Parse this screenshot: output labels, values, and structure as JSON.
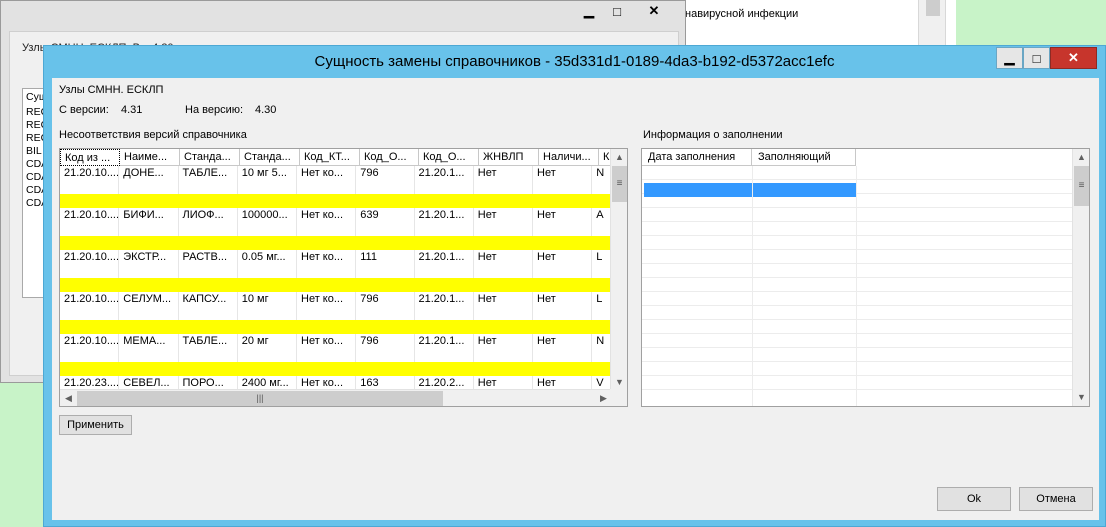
{
  "background_doc": {
    "text": "навирусной инфекции"
  },
  "background_window": {
    "label": "Узлы СМНН. ЕСКЛП. В...     4.30",
    "list_head": "Сущ",
    "list_items": [
      "REC",
      "REC",
      "REC",
      "BIL",
      "CDA",
      "CDA",
      "CDA",
      "CDA"
    ],
    "minimize": "▁",
    "maximize": "□",
    "close": "✕"
  },
  "dialog": {
    "title": "Сущность замены справочников - 35d331d1-0189-4da3-b192-d5372acc1efc",
    "minimize": "▁",
    "maximize": "□",
    "close": "✕",
    "subtitle": "Узлы СМНН. ЕСКЛП",
    "from_label": "С версии:",
    "from_value": "4.31",
    "to_label": "На версию:",
    "to_value": "4.30",
    "grid1_title": "Несоответствия версий справочника",
    "grid2_title": "Информация о заполнении",
    "apply_button": "Применить",
    "ok_button": "Ok",
    "cancel_button": "Отмена"
  },
  "grid1": {
    "headers": [
      "Код из ...",
      "Наиме...",
      "Станда...",
      "Станда...",
      "Код_КТ...",
      "Код_О...",
      "Код_О...",
      "ЖНВЛП",
      "Наличи...",
      "К"
    ],
    "rows": [
      [
        "21.20.10....",
        "ДОНЕ...",
        "ТАБЛЕ...",
        "10 мг 5...",
        "Нет ко...",
        "796",
        "21.20.1...",
        "Нет",
        "Нет",
        "N"
      ],
      [
        "21.20.10....",
        "БИФИ...",
        "ЛИОФ...",
        "100000...",
        "Нет ко...",
        "639",
        "21.20.1...",
        "Нет",
        "Нет",
        "А"
      ],
      [
        "21.20.10....",
        "ЭКСТР...",
        "РАСТВ...",
        "0.05 мг...",
        "Нет ко...",
        "111",
        "21.20.1...",
        "Нет",
        "Нет",
        "L"
      ],
      [
        "21.20.10....",
        "СЕЛУМ...",
        "КАПСУ...",
        "10 мг",
        "Нет ко...",
        "796",
        "21.20.1...",
        "Нет",
        "Нет",
        "L"
      ],
      [
        "21.20.10....",
        "МЕМА...",
        "ТАБЛЕ...",
        "20 мг",
        "Нет ко...",
        "796",
        "21.20.1...",
        "Нет",
        "Нет",
        "N"
      ],
      [
        "21.20.23....",
        "СЕВЕЛ...",
        "ПОРО...",
        "2400 мг...",
        "Нет ко...",
        "163",
        "21.20.2...",
        "Нет",
        "Нет",
        "V"
      ]
    ]
  },
  "grid2": {
    "headers": [
      "Дата заполнения",
      "Заполняющий"
    ]
  },
  "icons": {
    "scroll_up": "▲",
    "scroll_down": "▼",
    "scroll_left": "◀",
    "scroll_right": "▶",
    "grip_v": "≡",
    "grip_h": "|||"
  }
}
